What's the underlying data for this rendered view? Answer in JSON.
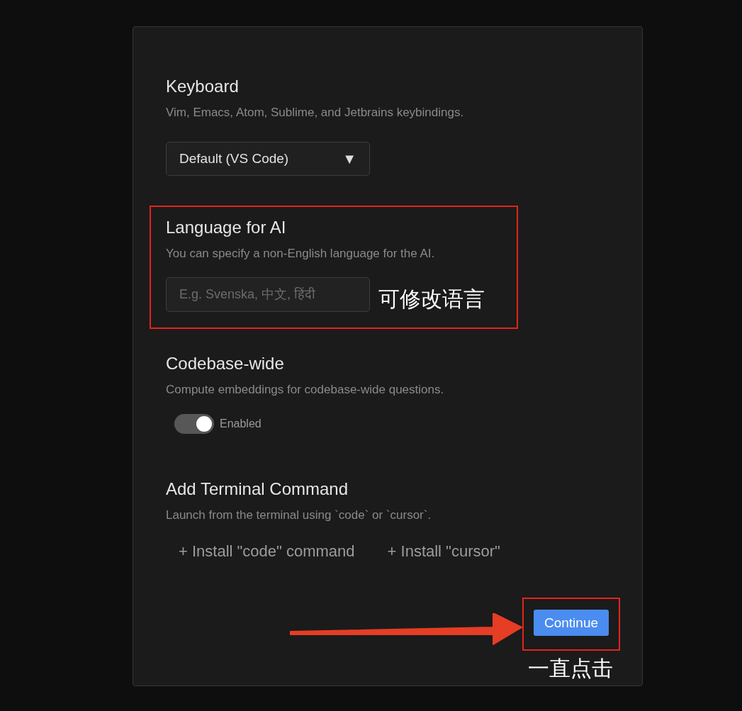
{
  "sections": [
    {
      "kind": "select",
      "title": "Keyboard",
      "description": "Vim, Emacs, Atom, Sublime, and Jetbrains keybindings.",
      "value": "Default (VS Code)",
      "caret": "▼",
      "highlighted": false
    },
    {
      "kind": "input",
      "title": "Language for AI",
      "description": "You can specify a non-English language for the AI.",
      "placeholder": "E.g. Svenska, 中文, हिंदी",
      "highlighted": true,
      "note": "可修改语言"
    },
    {
      "kind": "toggle",
      "title": "Codebase-wide",
      "description": "Compute embeddings for codebase-wide questions.",
      "on": true,
      "label": "Enabled",
      "highlighted": false
    },
    {
      "kind": "buttons",
      "title": "Add Terminal Command",
      "description": "Launch from the terminal using `code` or `cursor`.",
      "buttons": [
        "+ Install \"code\" command",
        "+ Install \"cursor\""
      ],
      "highlighted": false
    }
  ],
  "footer": {
    "button": "Continue",
    "highlighted": true,
    "arrow": true,
    "note": "一直点击"
  }
}
